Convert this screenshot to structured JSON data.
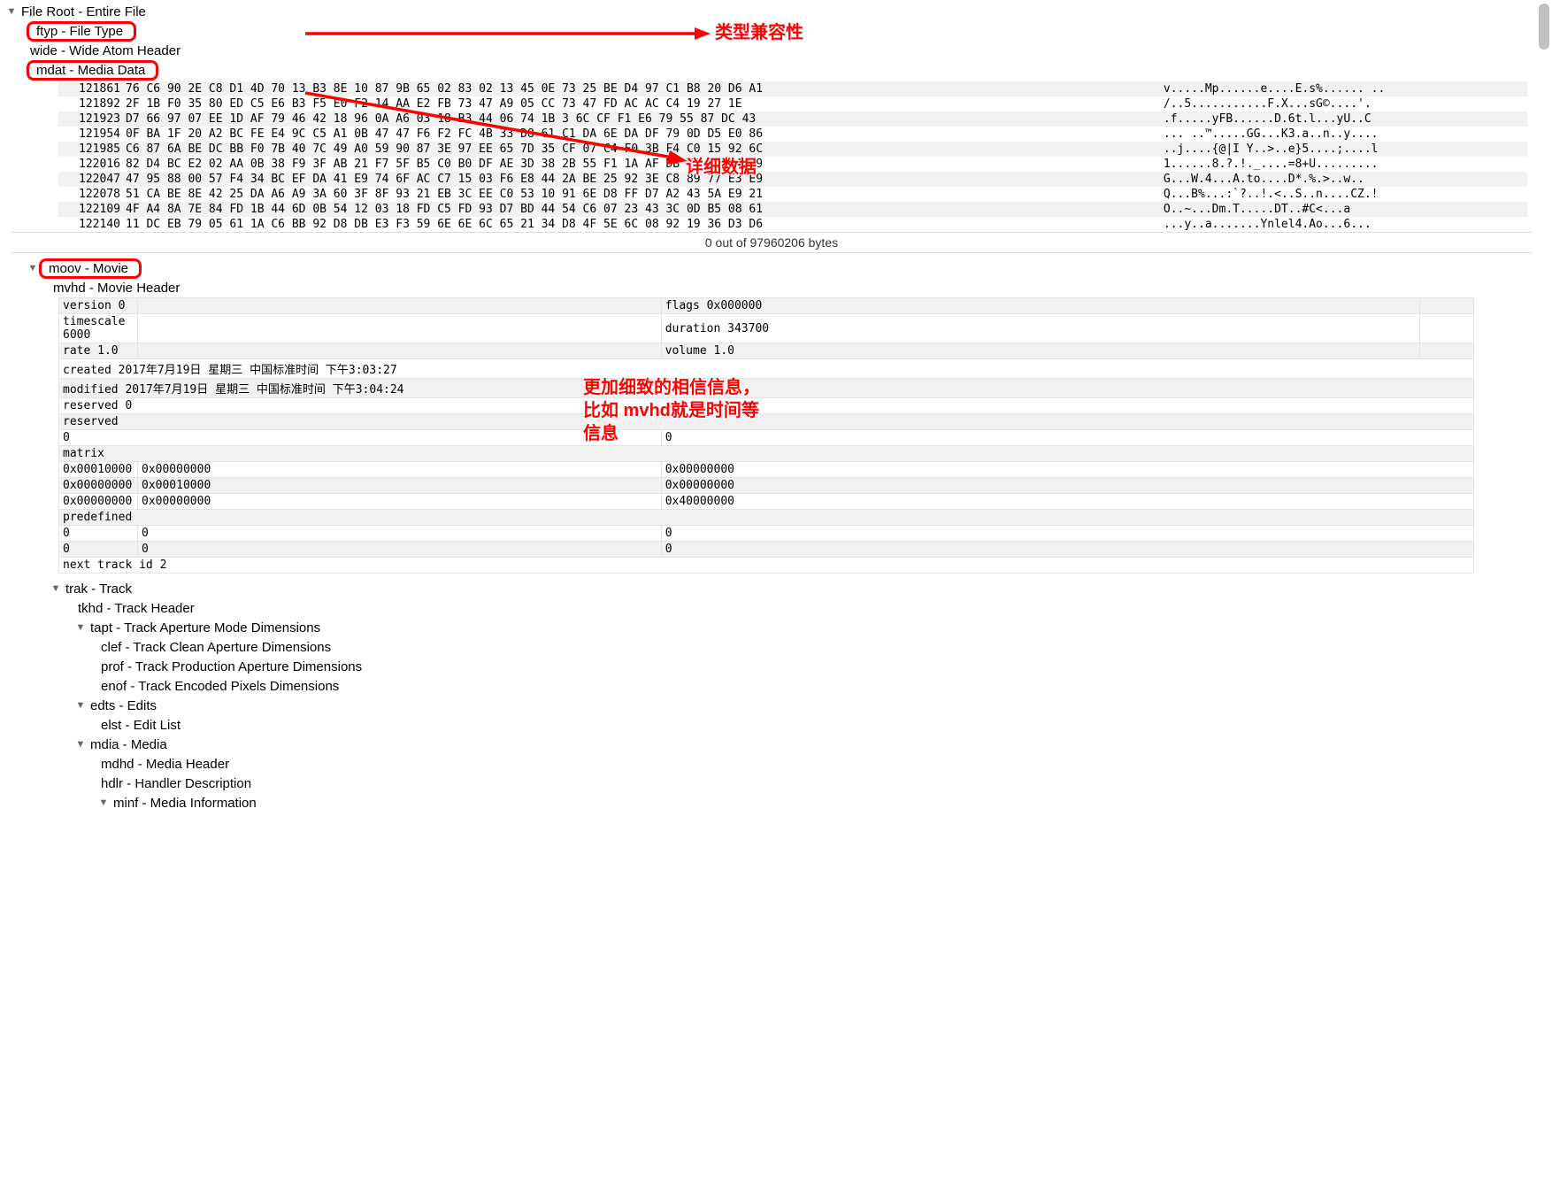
{
  "tree": {
    "file_root": "File Root - Entire File",
    "ftyp": "ftyp - File Type",
    "wide": "wide - Wide Atom Header",
    "mdat": "mdat - Media Data",
    "moov": "moov - Movie",
    "mvhd": "mvhd - Movie Header",
    "trak": "trak - Track",
    "tkhd": "tkhd - Track Header",
    "tapt": "tapt - Track Aperture Mode Dimensions",
    "clef": "clef - Track Clean Aperture Dimensions",
    "prof": "prof - Track Production Aperture Dimensions",
    "enof": "enof - Track Encoded Pixels Dimensions",
    "edts": "edts - Edits",
    "elst": "elst - Edit List",
    "mdia": "mdia - Media",
    "mdhd": "mdhd - Media Header",
    "hdlr": "hdlr - Handler Description",
    "minf": "minf - Media Information"
  },
  "annotations": {
    "type_compat": "类型兼容性",
    "detailed_data": "详细数据",
    "detailed_info1": "更加细致的相信信息，",
    "detailed_info2": "比如 mvhd就是时间等",
    "detailed_info3": "信息"
  },
  "hex": {
    "rows": [
      {
        "off": "121861",
        "b": "76 C6 90 2E C8 D1 4D 70 13 B3 8E 10 87 9B 65 02 83 02 13 45 0E 73 25 BE D4 97 C1 B8 20 D6 A1",
        "a": "v.....Mp......e....E.s%...... .."
      },
      {
        "off": "121892",
        "b": "2F 1B F0 35 80 ED C5 E6 B3 F5 E0 F2 14 AA E2 FB 73 47 A9 05 CC 73 47 FD AC AC C4 19 27 1E",
        "a": "/..5...........F.X...sG©....'."
      },
      {
        "off": "121923",
        "b": "D7 66 97 07 EE 1D AF 79 46 42 18 96 0A A6 03 18 B3 44 06 74 1B 3 6C CF F1 E6 79 55 87 DC 43",
        "a": ".f.....yFB......D.6t.l...yU..C"
      },
      {
        "off": "121954",
        "b": "0F BA 1F 20 A2 BC FE E4 9C C5 A1 0B 47 47 F6 F2 FC 4B 33 D8 61 C1 DA 6E DA DF 79 0D D5 E0 86",
        "a": "... ..™.....GG...K3.a..n..y...."
      },
      {
        "off": "121985",
        "b": "C6 87 6A BE DC BB F0 7B 40 7C 49 A0 59 90 87 3E 97 EE 65 7D 35 CF 07 C4 F0 3B F4 C0 15 92 6C",
        "a": "..j....{@|I Y..>..e}5....;....l"
      },
      {
        "off": "122016",
        "b": "82 D4 BC E2 02 AA 0B 38 F9 3F AB 21 F7 5F B5 C0 B0 DF AE 3D 38 2B 55 F1 1A AF DB FF F0 C4 09",
        "a": "1......8.?.!._....=8+U........."
      },
      {
        "off": "122047",
        "b": "47 95 88 00 57 F4 34 BC EF DA 41 E9 74 6F AC C7 15 03 F6 E8 44 2A BE 25 92 3E C8 89 77 E3 E9",
        "a": "G...W.4...A.to....D*.%.>..w.."
      },
      {
        "off": "122078",
        "b": "51 CA BE 8E 42 25 DA A6 A9 3A 60 3F 8F 93 21 EB 3C EE C0 53 10 91 6E D8 FF D7 A2 43 5A E9 21",
        "a": "Q...B%...:`?..!.<..S..n....CZ.!"
      },
      {
        "off": "122109",
        "b": "4F A4 8A 7E 84 FD 1B 44 6D 0B 54 12 03 18 FD C5 FD 93 D7 BD 44 54 C6 07 23 43 3C 0D B5 08 61",
        "a": "O..~...Dm.T.....DT..#C<...a"
      },
      {
        "off": "122140",
        "b": "11 DC EB 79 05 61 1A C6 BB 92 D8 DB E3 F3 59 6E 6E 6C 65 21 34 D8 4F 5E 6C 08 92 19 36 D3 D6",
        "a": "...y..a.......Ynlel4.Ao...6..."
      }
    ],
    "status": "0 out of 97960206 bytes"
  },
  "mvhd": {
    "version_k": "version",
    "version_v": "0",
    "flags_k": "flags",
    "flags_v": "0x000000",
    "timescale_k": "timescale",
    "timescale_v": "6000",
    "duration_k": "duration",
    "duration_v": "343700",
    "rate_k": "rate",
    "rate_v": "1.0",
    "volume_k": "volume",
    "volume_v": "1.0",
    "created_k": "created",
    "created_v": "2017年7月19日 星期三 中国标准时间 下午3:03:27",
    "modified_k": "modified",
    "modified_v": "2017年7月19日 星期三 中国标准时间 下午3:04:24",
    "reserved_k": "reserved",
    "reserved_v": "0",
    "reserved2_k": "reserved",
    "row0_a": "0",
    "row0_b": "0",
    "matrix_k": "matrix",
    "m00": "0x00010000",
    "m01": "0x00000000",
    "m02": "0x00000000",
    "m10": "0x00000000",
    "m11": "0x00010000",
    "m12": "0x00000000",
    "m20": "0x00000000",
    "m21": "0x00000000",
    "m22": "0x40000000",
    "predef_k": "predefined",
    "p0_a": "0",
    "p0_b": "0",
    "p0_c": "0",
    "p1_a": "0",
    "p1_b": "0",
    "p1_c": "0",
    "next_k": "next track id",
    "next_v": "2"
  }
}
